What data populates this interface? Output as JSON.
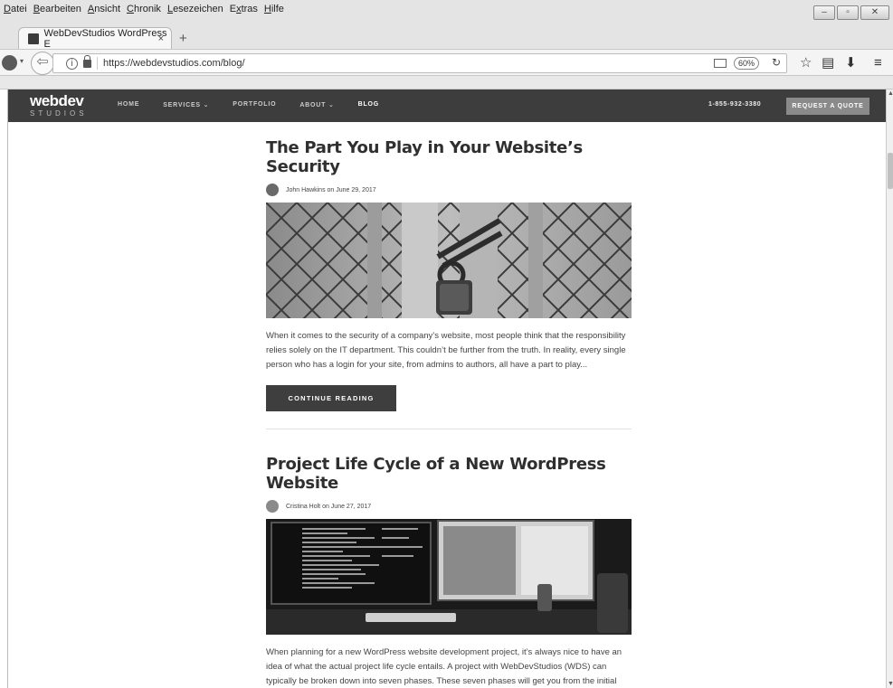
{
  "browser": {
    "menu": [
      "Datei",
      "Bearbeiten",
      "Ansicht",
      "Chronik",
      "Lesezeichen",
      "Extras",
      "Hilfe"
    ],
    "menu_underline": [
      "D",
      "B",
      "A",
      "C",
      "L",
      "x",
      "H"
    ],
    "tab_title": "WebDevStudios WordPress E",
    "tab_close": "×",
    "new_tab": "+",
    "url": "https://webdevstudios.com/blog/",
    "zoom": "60%"
  },
  "site": {
    "logo": "webdev",
    "logo_sub": "STUDIOS",
    "nav": [
      "HOME",
      "SERVICES ⌄",
      "PORTFOLIO",
      "ABOUT ⌄",
      "BLOG"
    ],
    "active_nav": "BLOG",
    "phone": "1-855-932-3380",
    "quote_button": "REQUEST A QUOTE"
  },
  "posts": [
    {
      "title": "The Part You Play in Your Website’s Security",
      "meta": "John Hawkins on June 29, 2017",
      "excerpt": "When it comes to the security of a company’s website, most people think that the responsibility relies solely on the IT department. This couldn’t be further from the truth. In reality, every single person who has a login for your site, from admins to authors, all have a part to play...",
      "button": "CONTINUE READING"
    },
    {
      "title": "Project Life Cycle of a New WordPress Website",
      "meta": "Cristina Holt on June 27, 2017",
      "excerpt": "When planning for a new WordPress website development project, it’s always nice to have an idea of what the actual project life cycle entails. A project with WebDevStudios (WDS) can typically be broken down into seven phases. These seven phases will get you from the initial proposal to a fresh new website for your company..."
    }
  ]
}
